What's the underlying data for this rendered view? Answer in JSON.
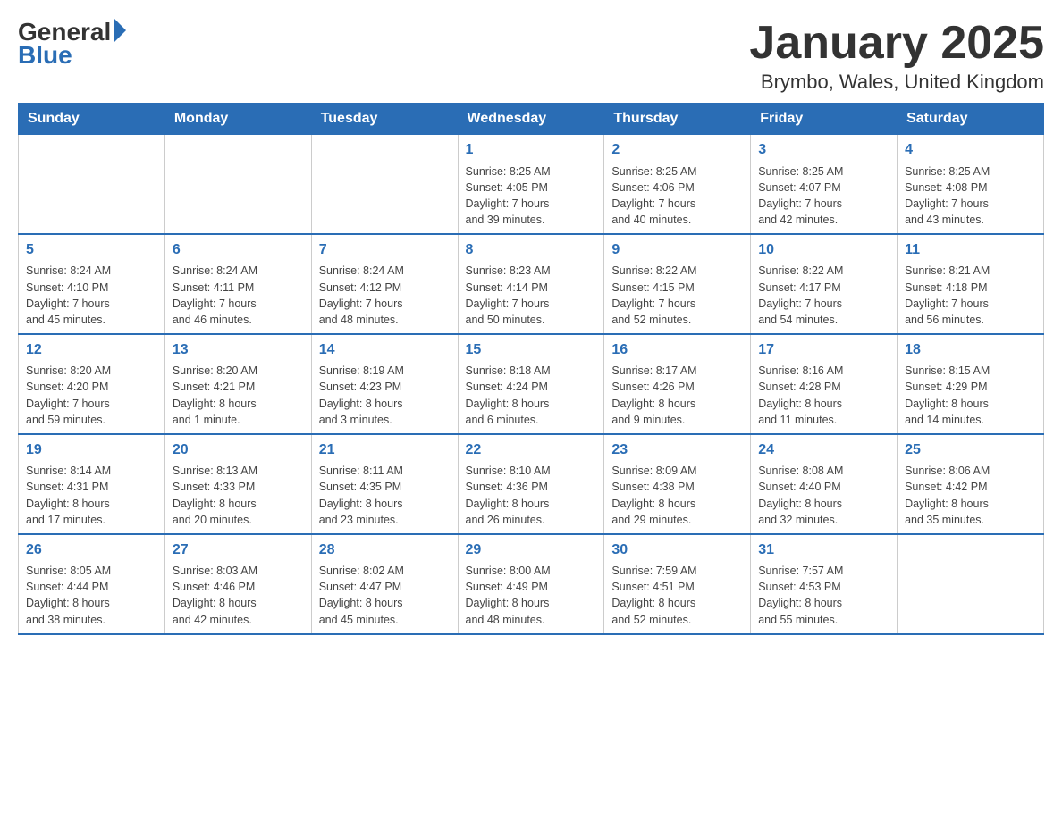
{
  "logo": {
    "general": "General",
    "blue": "Blue"
  },
  "header": {
    "title": "January 2025",
    "location": "Brymbo, Wales, United Kingdom"
  },
  "days_of_week": [
    "Sunday",
    "Monday",
    "Tuesday",
    "Wednesday",
    "Thursday",
    "Friday",
    "Saturday"
  ],
  "weeks": [
    [
      {
        "day": "",
        "info": ""
      },
      {
        "day": "",
        "info": ""
      },
      {
        "day": "",
        "info": ""
      },
      {
        "day": "1",
        "info": "Sunrise: 8:25 AM\nSunset: 4:05 PM\nDaylight: 7 hours\nand 39 minutes."
      },
      {
        "day": "2",
        "info": "Sunrise: 8:25 AM\nSunset: 4:06 PM\nDaylight: 7 hours\nand 40 minutes."
      },
      {
        "day": "3",
        "info": "Sunrise: 8:25 AM\nSunset: 4:07 PM\nDaylight: 7 hours\nand 42 minutes."
      },
      {
        "day": "4",
        "info": "Sunrise: 8:25 AM\nSunset: 4:08 PM\nDaylight: 7 hours\nand 43 minutes."
      }
    ],
    [
      {
        "day": "5",
        "info": "Sunrise: 8:24 AM\nSunset: 4:10 PM\nDaylight: 7 hours\nand 45 minutes."
      },
      {
        "day": "6",
        "info": "Sunrise: 8:24 AM\nSunset: 4:11 PM\nDaylight: 7 hours\nand 46 minutes."
      },
      {
        "day": "7",
        "info": "Sunrise: 8:24 AM\nSunset: 4:12 PM\nDaylight: 7 hours\nand 48 minutes."
      },
      {
        "day": "8",
        "info": "Sunrise: 8:23 AM\nSunset: 4:14 PM\nDaylight: 7 hours\nand 50 minutes."
      },
      {
        "day": "9",
        "info": "Sunrise: 8:22 AM\nSunset: 4:15 PM\nDaylight: 7 hours\nand 52 minutes."
      },
      {
        "day": "10",
        "info": "Sunrise: 8:22 AM\nSunset: 4:17 PM\nDaylight: 7 hours\nand 54 minutes."
      },
      {
        "day": "11",
        "info": "Sunrise: 8:21 AM\nSunset: 4:18 PM\nDaylight: 7 hours\nand 56 minutes."
      }
    ],
    [
      {
        "day": "12",
        "info": "Sunrise: 8:20 AM\nSunset: 4:20 PM\nDaylight: 7 hours\nand 59 minutes."
      },
      {
        "day": "13",
        "info": "Sunrise: 8:20 AM\nSunset: 4:21 PM\nDaylight: 8 hours\nand 1 minute."
      },
      {
        "day": "14",
        "info": "Sunrise: 8:19 AM\nSunset: 4:23 PM\nDaylight: 8 hours\nand 3 minutes."
      },
      {
        "day": "15",
        "info": "Sunrise: 8:18 AM\nSunset: 4:24 PM\nDaylight: 8 hours\nand 6 minutes."
      },
      {
        "day": "16",
        "info": "Sunrise: 8:17 AM\nSunset: 4:26 PM\nDaylight: 8 hours\nand 9 minutes."
      },
      {
        "day": "17",
        "info": "Sunrise: 8:16 AM\nSunset: 4:28 PM\nDaylight: 8 hours\nand 11 minutes."
      },
      {
        "day": "18",
        "info": "Sunrise: 8:15 AM\nSunset: 4:29 PM\nDaylight: 8 hours\nand 14 minutes."
      }
    ],
    [
      {
        "day": "19",
        "info": "Sunrise: 8:14 AM\nSunset: 4:31 PM\nDaylight: 8 hours\nand 17 minutes."
      },
      {
        "day": "20",
        "info": "Sunrise: 8:13 AM\nSunset: 4:33 PM\nDaylight: 8 hours\nand 20 minutes."
      },
      {
        "day": "21",
        "info": "Sunrise: 8:11 AM\nSunset: 4:35 PM\nDaylight: 8 hours\nand 23 minutes."
      },
      {
        "day": "22",
        "info": "Sunrise: 8:10 AM\nSunset: 4:36 PM\nDaylight: 8 hours\nand 26 minutes."
      },
      {
        "day": "23",
        "info": "Sunrise: 8:09 AM\nSunset: 4:38 PM\nDaylight: 8 hours\nand 29 minutes."
      },
      {
        "day": "24",
        "info": "Sunrise: 8:08 AM\nSunset: 4:40 PM\nDaylight: 8 hours\nand 32 minutes."
      },
      {
        "day": "25",
        "info": "Sunrise: 8:06 AM\nSunset: 4:42 PM\nDaylight: 8 hours\nand 35 minutes."
      }
    ],
    [
      {
        "day": "26",
        "info": "Sunrise: 8:05 AM\nSunset: 4:44 PM\nDaylight: 8 hours\nand 38 minutes."
      },
      {
        "day": "27",
        "info": "Sunrise: 8:03 AM\nSunset: 4:46 PM\nDaylight: 8 hours\nand 42 minutes."
      },
      {
        "day": "28",
        "info": "Sunrise: 8:02 AM\nSunset: 4:47 PM\nDaylight: 8 hours\nand 45 minutes."
      },
      {
        "day": "29",
        "info": "Sunrise: 8:00 AM\nSunset: 4:49 PM\nDaylight: 8 hours\nand 48 minutes."
      },
      {
        "day": "30",
        "info": "Sunrise: 7:59 AM\nSunset: 4:51 PM\nDaylight: 8 hours\nand 52 minutes."
      },
      {
        "day": "31",
        "info": "Sunrise: 7:57 AM\nSunset: 4:53 PM\nDaylight: 8 hours\nand 55 minutes."
      },
      {
        "day": "",
        "info": ""
      }
    ]
  ]
}
